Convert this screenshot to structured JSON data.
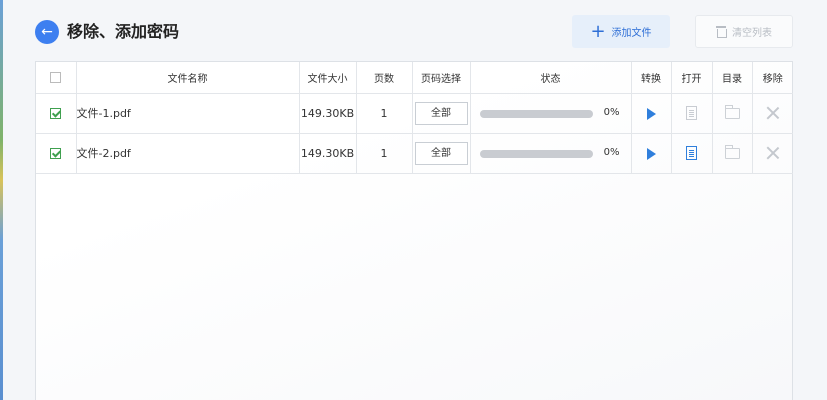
{
  "header": {
    "title": "移除、添加密码",
    "back_icon": "arrow-left-icon",
    "add_label": "添加文件",
    "clear_label": "清空列表"
  },
  "table": {
    "columns": [
      "",
      "文件名称",
      "文件大小",
      "页数",
      "页码选择",
      "状态",
      "转换",
      "打开",
      "目录",
      "移除"
    ],
    "rows": [
      {
        "checked": true,
        "name": "文件-1.pdf",
        "size": "149.30KB",
        "pages": "1",
        "page_select": "全部",
        "progress": "0%",
        "open_enabled": false
      },
      {
        "checked": true,
        "name": "文件-2.pdf",
        "size": "149.30KB",
        "pages": "1",
        "page_select": "全部",
        "progress": "0%",
        "open_enabled": true
      }
    ]
  },
  "colors": {
    "accent": "#3d7ff0",
    "check": "#3fa04f"
  }
}
